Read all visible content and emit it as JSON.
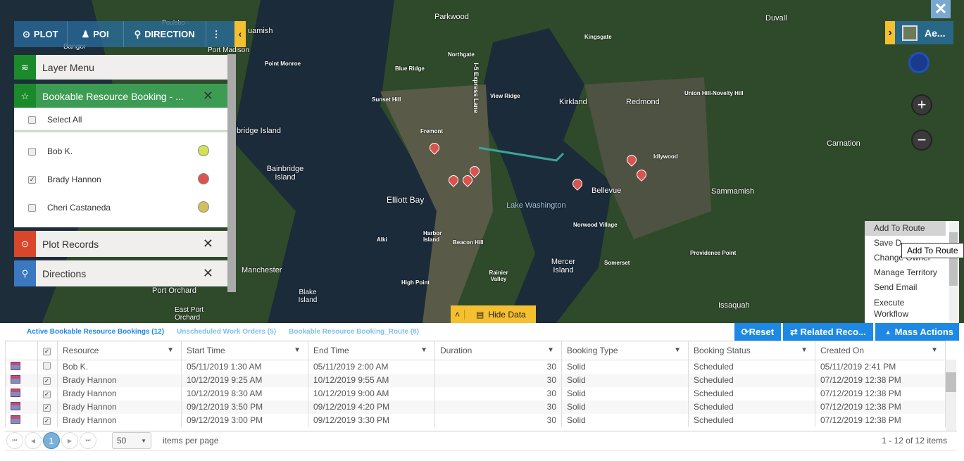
{
  "toolbar": {
    "plot": "PLOT",
    "poi": "POI",
    "direction": "DIRECTION"
  },
  "panels": {
    "layer_menu": "Layer Menu",
    "booking": "Bookable Resource Booking - ...",
    "select_all": "Select All",
    "plot_records": "Plot Records",
    "directions": "Directions",
    "resources": [
      {
        "name": "Bob K.",
        "checked": false,
        "color": "#d4e157"
      },
      {
        "name": "Brady Hannon",
        "checked": true,
        "color": "#d9534f"
      },
      {
        "name": "Cheri Castaneda",
        "checked": false,
        "color": "#d4c05a"
      }
    ]
  },
  "map": {
    "layer_label": "Ae...",
    "labels": [
      "Parkwood",
      "Duvall",
      "Kingsgate",
      "Northgate",
      "Point Monroe",
      "Blue Ridge",
      "I-5 Express Lane",
      "View Ridge",
      "Union Hill-Novelty Hill",
      "Sunset Hill",
      "Kirkland",
      "Redmond",
      "Fremont",
      "Idlywood",
      "Carnation",
      "Bainbridge Island",
      "Elliott Bay",
      "Bellevue",
      "Lake Washington",
      "Sammamish",
      "Norwood Village",
      "Harbor Island",
      "Alki",
      "Beacon Hill",
      "Mercer Island",
      "Providence Point",
      "Somerset",
      "Manchester",
      "Rainier Valley",
      "High Point",
      "Port Orchard",
      "Blake Island",
      "East Port Orchard",
      "Issaquah",
      "uamish",
      "bridge Island",
      "Poulsbo",
      "Bangor",
      "Port Madison"
    ]
  },
  "context_menu": {
    "items": [
      "Add To Route",
      "Save D",
      "Change Owner",
      "Manage Territory",
      "Send Email",
      "Execute Workflow"
    ],
    "tooltip": "Add To Route"
  },
  "hide_data": "Hide Data",
  "grid": {
    "tabs": [
      "Active Bookable Resource Bookings (12)",
      "Unscheduled Work Orders (5)",
      "Bookable Resource Booking_Route (8)"
    ],
    "actions": {
      "reset": "Reset",
      "related": "Related Reco...",
      "mass": "Mass Actions"
    },
    "columns": [
      "Resource",
      "Start Time",
      "End Time",
      "Duration",
      "Booking Type",
      "Booking Status",
      "Created On"
    ],
    "rows": [
      {
        "checked": false,
        "cells": [
          "Bob K.",
          "05/11/2019 1:30 AM",
          "05/11/2019 2:00 AM",
          "30",
          "Solid",
          "Scheduled",
          "05/11/2019 2:41 PM"
        ]
      },
      {
        "checked": true,
        "cells": [
          "Brady Hannon",
          "10/12/2019 9:25 AM",
          "10/12/2019 9:55 AM",
          "30",
          "Solid",
          "Scheduled",
          "07/12/2019 12:38 PM"
        ]
      },
      {
        "checked": true,
        "cells": [
          "Brady Hannon",
          "10/12/2019 8:30 AM",
          "10/12/2019 9:00 AM",
          "30",
          "Solid",
          "Scheduled",
          "07/12/2019 12:38 PM"
        ]
      },
      {
        "checked": true,
        "cells": [
          "Brady Hannon",
          "09/12/2019 3:50 PM",
          "09/12/2019 4:20 PM",
          "30",
          "Solid",
          "Scheduled",
          "07/12/2019 12:38 PM"
        ]
      },
      {
        "checked": true,
        "cells": [
          "Brady Hannon",
          "09/12/2019 3:00 PM",
          "09/12/2019 3:30 PM",
          "30",
          "Solid",
          "Scheduled",
          "07/12/2019 12:38 PM"
        ]
      }
    ],
    "pager": {
      "page": "1",
      "page_size": "50",
      "items_per_page": "items per page",
      "summary": "1 - 12 of 12 items"
    }
  }
}
